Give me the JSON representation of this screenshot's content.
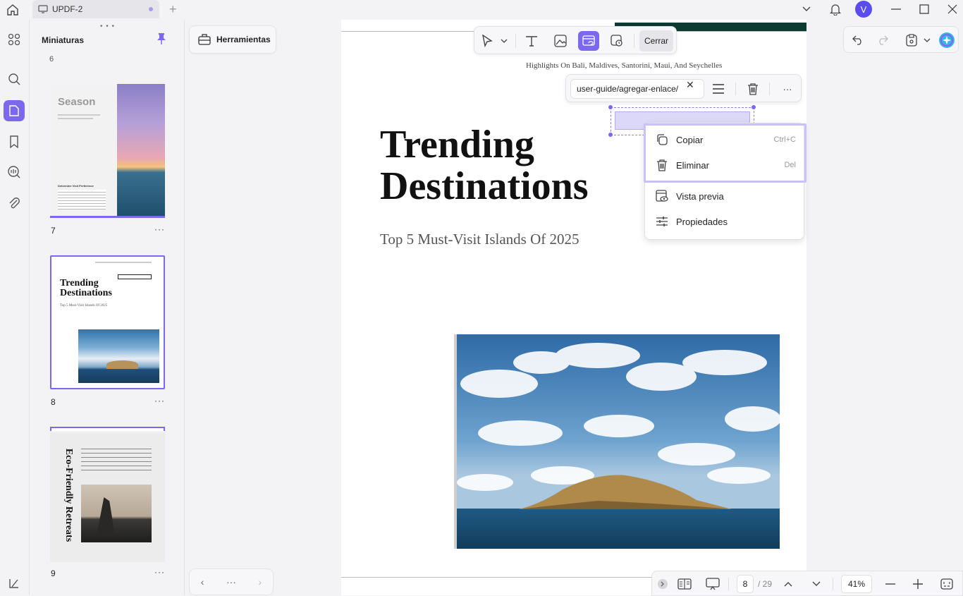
{
  "tab": {
    "title": "UPDF-2"
  },
  "window": {
    "user_initial": "V"
  },
  "thumbnails": {
    "header": "Miniaturas",
    "top_partial_number": "6",
    "pages": [
      {
        "number": "7",
        "title": "Season",
        "subtitle": "Determine Visit Preference",
        "more": "···"
      },
      {
        "number": "8",
        "title": "Trending Destinations",
        "subtitle": "Top 5 Must-Visit Islands Of 2025",
        "more": "···"
      },
      {
        "number": "9",
        "title": "Eco-Friendly Retreats",
        "more": "···"
      }
    ]
  },
  "tools": {
    "header_label": "Herramientas",
    "pager_more": "···"
  },
  "toolbar": {
    "close_label": "Cerrar"
  },
  "document": {
    "highlights": "Highlights On Bali, Maldives, Santorini, Maui, And  Seychelles",
    "title_line1": "Trending",
    "title_line2": "Destinations",
    "subtitle": "Top 5 Must-Visit Islands Of 2025"
  },
  "link_popup": {
    "url": "user-guide/agregar-enlace/",
    "more": "···"
  },
  "context_menu": {
    "items": [
      {
        "label": "Copiar",
        "shortcut": "Ctrl+C"
      },
      {
        "label": "Eliminar",
        "shortcut": "Del"
      },
      {
        "label": "Vista previa"
      },
      {
        "label": "Propiedades"
      }
    ]
  },
  "bottom_bar": {
    "current_page": "8",
    "total_pages": "/ 29",
    "zoom": "41%"
  },
  "colors": {
    "accent": "#7b68ee",
    "selection_highlight": "#c9c1f7",
    "panel_bg": "#f3f3f5"
  }
}
